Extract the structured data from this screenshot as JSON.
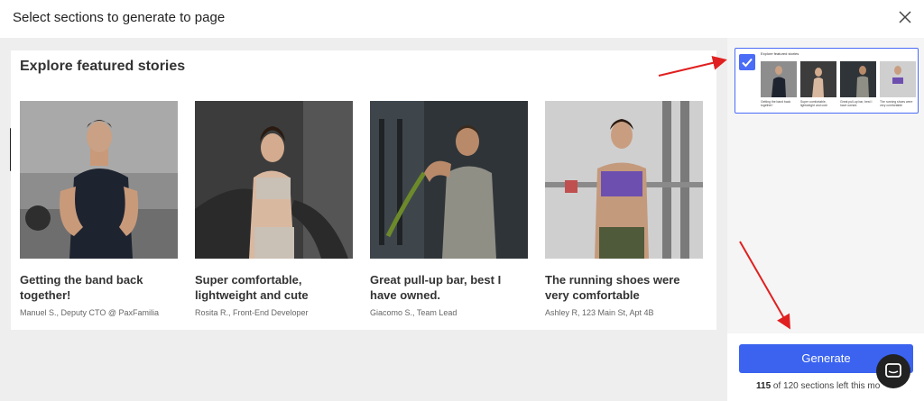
{
  "modal": {
    "title": "Select sections to generate to page",
    "close_icon": "close-icon"
  },
  "section": {
    "heading": "Explore featured stories",
    "stories": [
      {
        "quote": "Getting the band back together!",
        "author": "Manuel S., Deputy CTO @ PaxFamilia"
      },
      {
        "quote": "Super comfortable, lightweight and cute",
        "author": "Rosita R., Front-End Developer"
      },
      {
        "quote": "Great pull-up bar, best I have owned.",
        "author": "Giacomo S., Team Lead"
      },
      {
        "quote": "The running shoes were very comfortable",
        "author": "Ashley R, 123 Main St, Apt 4B"
      }
    ]
  },
  "sidebar": {
    "thumbnail": {
      "title": "Explore featured stories",
      "checked": true,
      "items": [
        {
          "text": "Getting the band back together!"
        },
        {
          "text": "Super comfortable, lightweight and cute"
        },
        {
          "text": "Great pull-up bar, best I have owned."
        },
        {
          "text": "The running shoes were very comfortable"
        }
      ]
    },
    "generate_label": "Generate",
    "credits": {
      "used": "115",
      "rest": "of 120 sections left this mo"
    }
  },
  "colors": {
    "accent": "#3b63f0",
    "annotation_arrow": "#e02020"
  }
}
